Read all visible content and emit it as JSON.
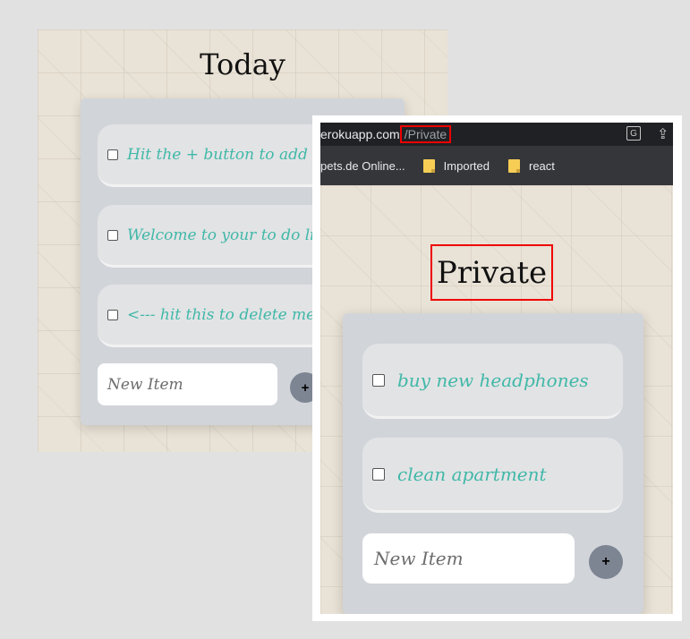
{
  "today": {
    "title": "Today",
    "items": [
      {
        "text": "Hit the + button to add new item."
      },
      {
        "text": "Welcome to your to do list."
      },
      {
        "text": "<--- hit this to delete me."
      }
    ],
    "new_item_placeholder": "New Item",
    "add_button_label": "+"
  },
  "browser": {
    "url_host": "erokuapp.com",
    "url_path": "/Private",
    "bookmarks": [
      {
        "label": "pets.de Online..."
      },
      {
        "label": "Imported",
        "icon": "folder-icon"
      },
      {
        "label": "react",
        "icon": "folder-icon"
      }
    ]
  },
  "private": {
    "title": "Private",
    "items": [
      {
        "text": "buy new headphones"
      },
      {
        "text": "clean apartment"
      }
    ],
    "new_item_placeholder": "New Item",
    "add_button_label": "+"
  },
  "colors": {
    "item_text": "#40b8a8",
    "card_bg": "#d1d5da",
    "add_button": "#7d8593",
    "highlight_box": "#e00000"
  }
}
